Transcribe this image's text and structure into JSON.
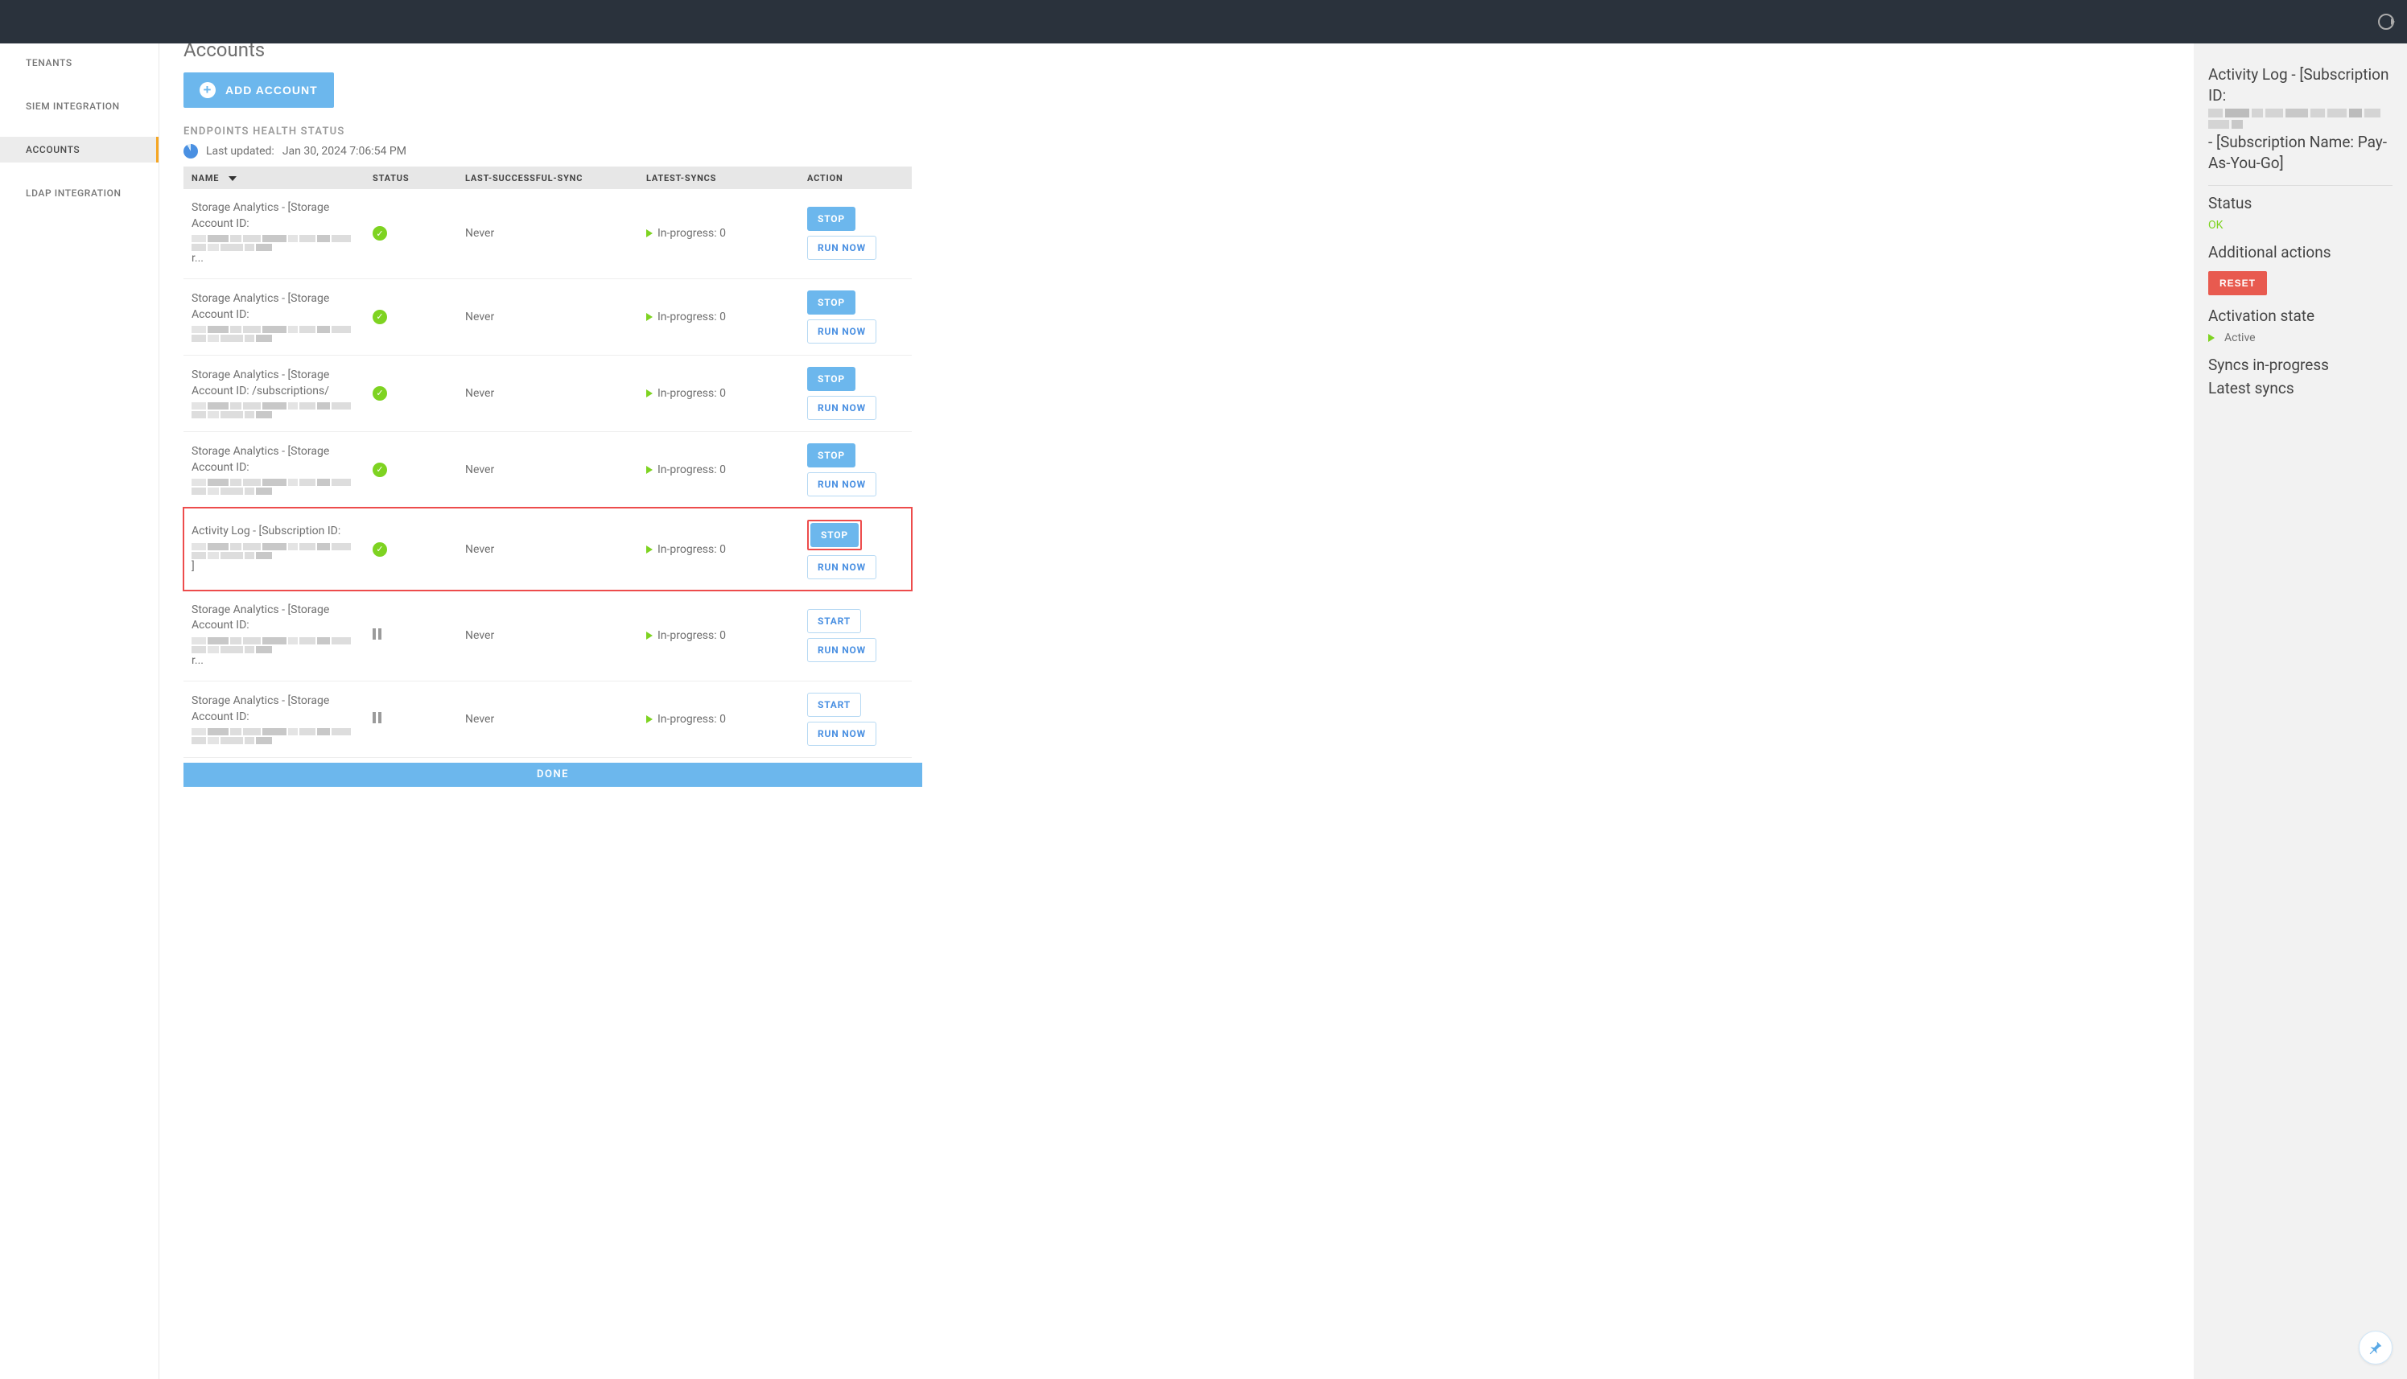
{
  "sidebar": {
    "items": [
      {
        "label": "TENANTS"
      },
      {
        "label": "SIEM INTEGRATION"
      },
      {
        "label": "ACCOUNTS"
      },
      {
        "label": "LDAP INTEGRATION"
      }
    ],
    "active_index": 2
  },
  "page": {
    "title": "Accounts",
    "add_button": "ADD ACCOUNT",
    "health_label": "ENDPOINTS HEALTH STATUS",
    "last_updated_prefix": "Last updated: ",
    "last_updated": "Jan 30, 2024 7:06:54 PM",
    "done_label": "DONE"
  },
  "table": {
    "headers": {
      "name": "NAME",
      "status": "STATUS",
      "last_sync": "LAST-SUCCESSFUL-SYNC",
      "latest": "LATEST-SYNCS",
      "action": "ACTION"
    },
    "stop_label": "STOP",
    "start_label": "START",
    "run_label": "RUN NOW",
    "in_progress_prefix": "In-progress: ",
    "rows": [
      {
        "name": "Storage Analytics - [Storage Account ID:",
        "name_suffix_text": "r...",
        "status": "ok",
        "last_sync": "Never",
        "in_progress": 0,
        "action_primary": "stop",
        "highlighted": false
      },
      {
        "name": "Storage Analytics - [Storage Account ID:",
        "name_suffix_text": "",
        "status": "ok",
        "last_sync": "Never",
        "in_progress": 0,
        "action_primary": "stop",
        "highlighted": false
      },
      {
        "name": "Storage Analytics - [Storage Account ID: /subscriptions/",
        "name_suffix_text": "",
        "status": "ok",
        "last_sync": "Never",
        "in_progress": 0,
        "action_primary": "stop",
        "highlighted": false
      },
      {
        "name": "Storage Analytics - [Storage Account ID:",
        "name_suffix_text": "",
        "status": "ok",
        "last_sync": "Never",
        "in_progress": 0,
        "action_primary": "stop",
        "highlighted": false
      },
      {
        "name": "Activity Log - [Subscription ID:",
        "name_suffix_text": "]",
        "status": "ok",
        "last_sync": "Never",
        "in_progress": 0,
        "action_primary": "stop",
        "highlighted": true
      },
      {
        "name": "Storage Analytics - [Storage Account ID:",
        "name_suffix_text": "r...",
        "status": "paused",
        "last_sync": "Never",
        "in_progress": 0,
        "action_primary": "start",
        "highlighted": false
      },
      {
        "name": "Storage Analytics - [Storage Account ID:",
        "name_suffix_text": "",
        "status": "paused",
        "last_sync": "Never",
        "in_progress": 0,
        "action_primary": "start",
        "highlighted": false
      }
    ]
  },
  "info_panel": {
    "title_prefix": "Activity Log - [Subscription ID:",
    "title_suffix": " - [Subscription Name: Pay-As-You-Go]",
    "status_label": "Status",
    "status_value": "OK",
    "additional_label": "Additional actions",
    "reset_label": "RESET",
    "activation_label": "Activation state",
    "activation_value": "Active",
    "syncs_label": "Syncs in-progress",
    "latest_label": "Latest syncs"
  }
}
